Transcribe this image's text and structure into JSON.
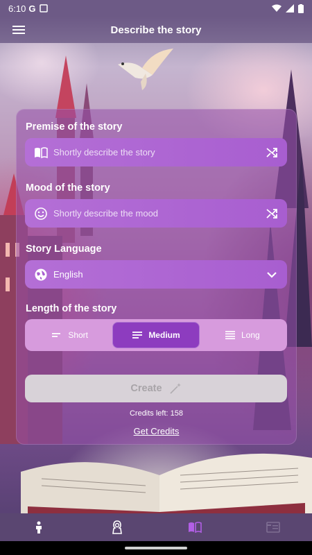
{
  "status_bar": {
    "time": "6:10",
    "g_label": "G"
  },
  "app_bar": {
    "title": "Describe the story",
    "menu_icon": "hamburger-menu-icon"
  },
  "form": {
    "premise": {
      "label": "Premise of the story",
      "placeholder": "Shortly describe the story",
      "icon": "open-book-icon",
      "action_icon": "shuffle-icon"
    },
    "mood": {
      "label": "Mood of the story",
      "placeholder": "Shortly describe the mood",
      "icon": "smiley-icon",
      "action_icon": "shuffle-icon"
    },
    "language": {
      "label": "Story Language",
      "value": "English",
      "icon": "globe-icon",
      "action_icon": "chevron-down-icon"
    },
    "length": {
      "label": "Length of the story",
      "options": [
        {
          "label": "Short",
          "selected": false
        },
        {
          "label": "Medium",
          "selected": true
        },
        {
          "label": "Long",
          "selected": false
        }
      ]
    },
    "create_label": "Create",
    "credits_text": "Credits left: 158",
    "get_credits_label": "Get Credits"
  },
  "bottom_nav": {
    "tabs": [
      {
        "icon": "person-icon",
        "active": false
      },
      {
        "icon": "character-icon",
        "active": false
      },
      {
        "icon": "book-icon",
        "active": true
      },
      {
        "icon": "list-icon",
        "active": false
      }
    ]
  },
  "colors": {
    "card": "#9650aa",
    "field": "#b46fd6",
    "segment_active": "#8d3cbf",
    "segment_bg": "#d79bdd",
    "create_disabled": "#d8d2d8",
    "nav_bg": "#5a4671",
    "nav_active": "#b25fe6"
  }
}
